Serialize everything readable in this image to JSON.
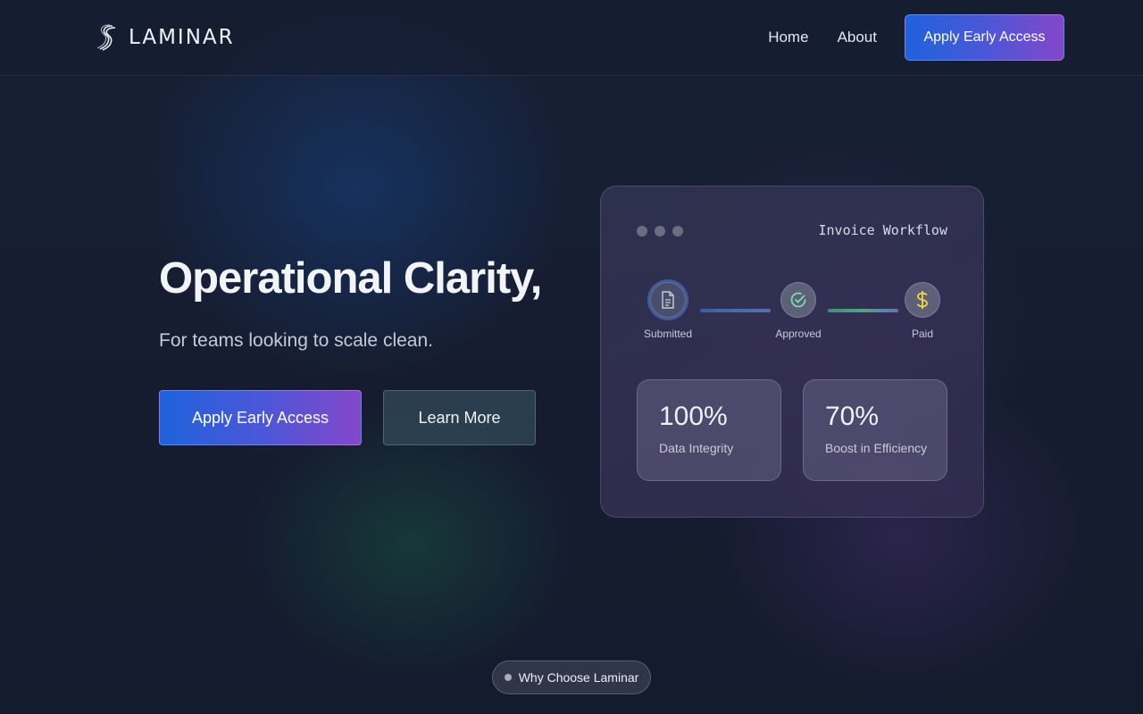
{
  "header": {
    "logo_text": "LAMINAR",
    "nav": [
      {
        "label": "Home"
      },
      {
        "label": "About"
      }
    ],
    "cta_label": "Apply Early Access"
  },
  "hero": {
    "title": "Operational Clarity,",
    "subtitle": "For teams looking to scale clean.",
    "primary_cta": "Apply Early Access",
    "secondary_cta": "Learn More"
  },
  "workflow_card": {
    "title": "Invoice Workflow",
    "steps": [
      {
        "label": "Submitted",
        "icon": "document-icon"
      },
      {
        "label": "Approved",
        "icon": "check-circle-icon"
      },
      {
        "label": "Paid",
        "icon": "dollar-icon"
      }
    ],
    "stats": [
      {
        "value": "100%",
        "caption": "Data Integrity"
      },
      {
        "value": "70%",
        "caption": "Boost in Efficiency"
      }
    ]
  },
  "section_pill": {
    "label": "Why Choose Laminar"
  },
  "colors": {
    "accent_start": "#1f62dc",
    "accent_end": "#8447c9",
    "check_green": "#7ee0b0",
    "dollar_yellow": "#f2d544",
    "background": "#151c2e"
  }
}
